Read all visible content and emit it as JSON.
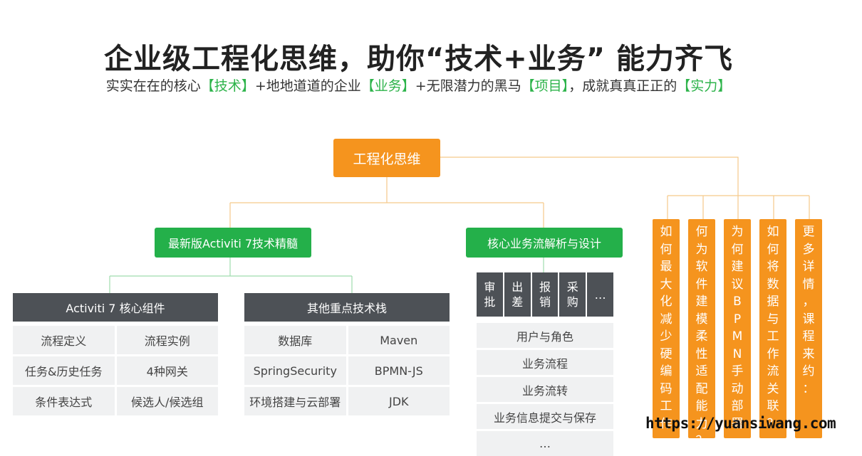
{
  "title": "企业级工程化思维，助你“技术+业务” 能力齐飞",
  "subtitle": {
    "p1": "实实在在的核心",
    "h1": "【技术】",
    "p2": "+地地道道的企业",
    "h2": "【业务】",
    "p3": "+无限潜力的黑马",
    "h3": "【项目】",
    "p4": "，成就真真正正的",
    "h4": "【实力】"
  },
  "root": "工程化思维",
  "branches": {
    "activiti": "最新版Activiti 7技术精髓",
    "business": "核心业务流解析与设计"
  },
  "core_group": {
    "header": "Activiti 7 核心组件",
    "items": [
      "流程定义",
      "流程实例",
      "任务&历史任务",
      "4种网关",
      "条件表达式",
      "候选人/候选组"
    ]
  },
  "stack_group": {
    "header": "其他重点技术栈",
    "items": [
      "数据库",
      "Maven",
      "SpringSecurity",
      "BPMN-JS",
      "环境搭建与云部署",
      "JDK"
    ]
  },
  "approval_types": [
    "审批",
    "出差",
    "报销",
    "采购",
    "…"
  ],
  "business_items": [
    "用户与角色",
    "业务流程",
    "业务流转",
    "业务信息提交与保存",
    "…"
  ],
  "questions": [
    "如何最大化减少硬编码工作",
    "何为软件建模柔性适配能力？",
    "为何建议BPMN手动部署",
    "如何将数据与工作流关联？",
    "更多详情，课程来约："
  ],
  "colors": {
    "orange": "#f5941e",
    "green": "#24b04a",
    "dark": "#4d5156",
    "light": "#f0f1f2",
    "highlight": "#2db34a"
  },
  "watermark": "https://yuansiwang.com"
}
